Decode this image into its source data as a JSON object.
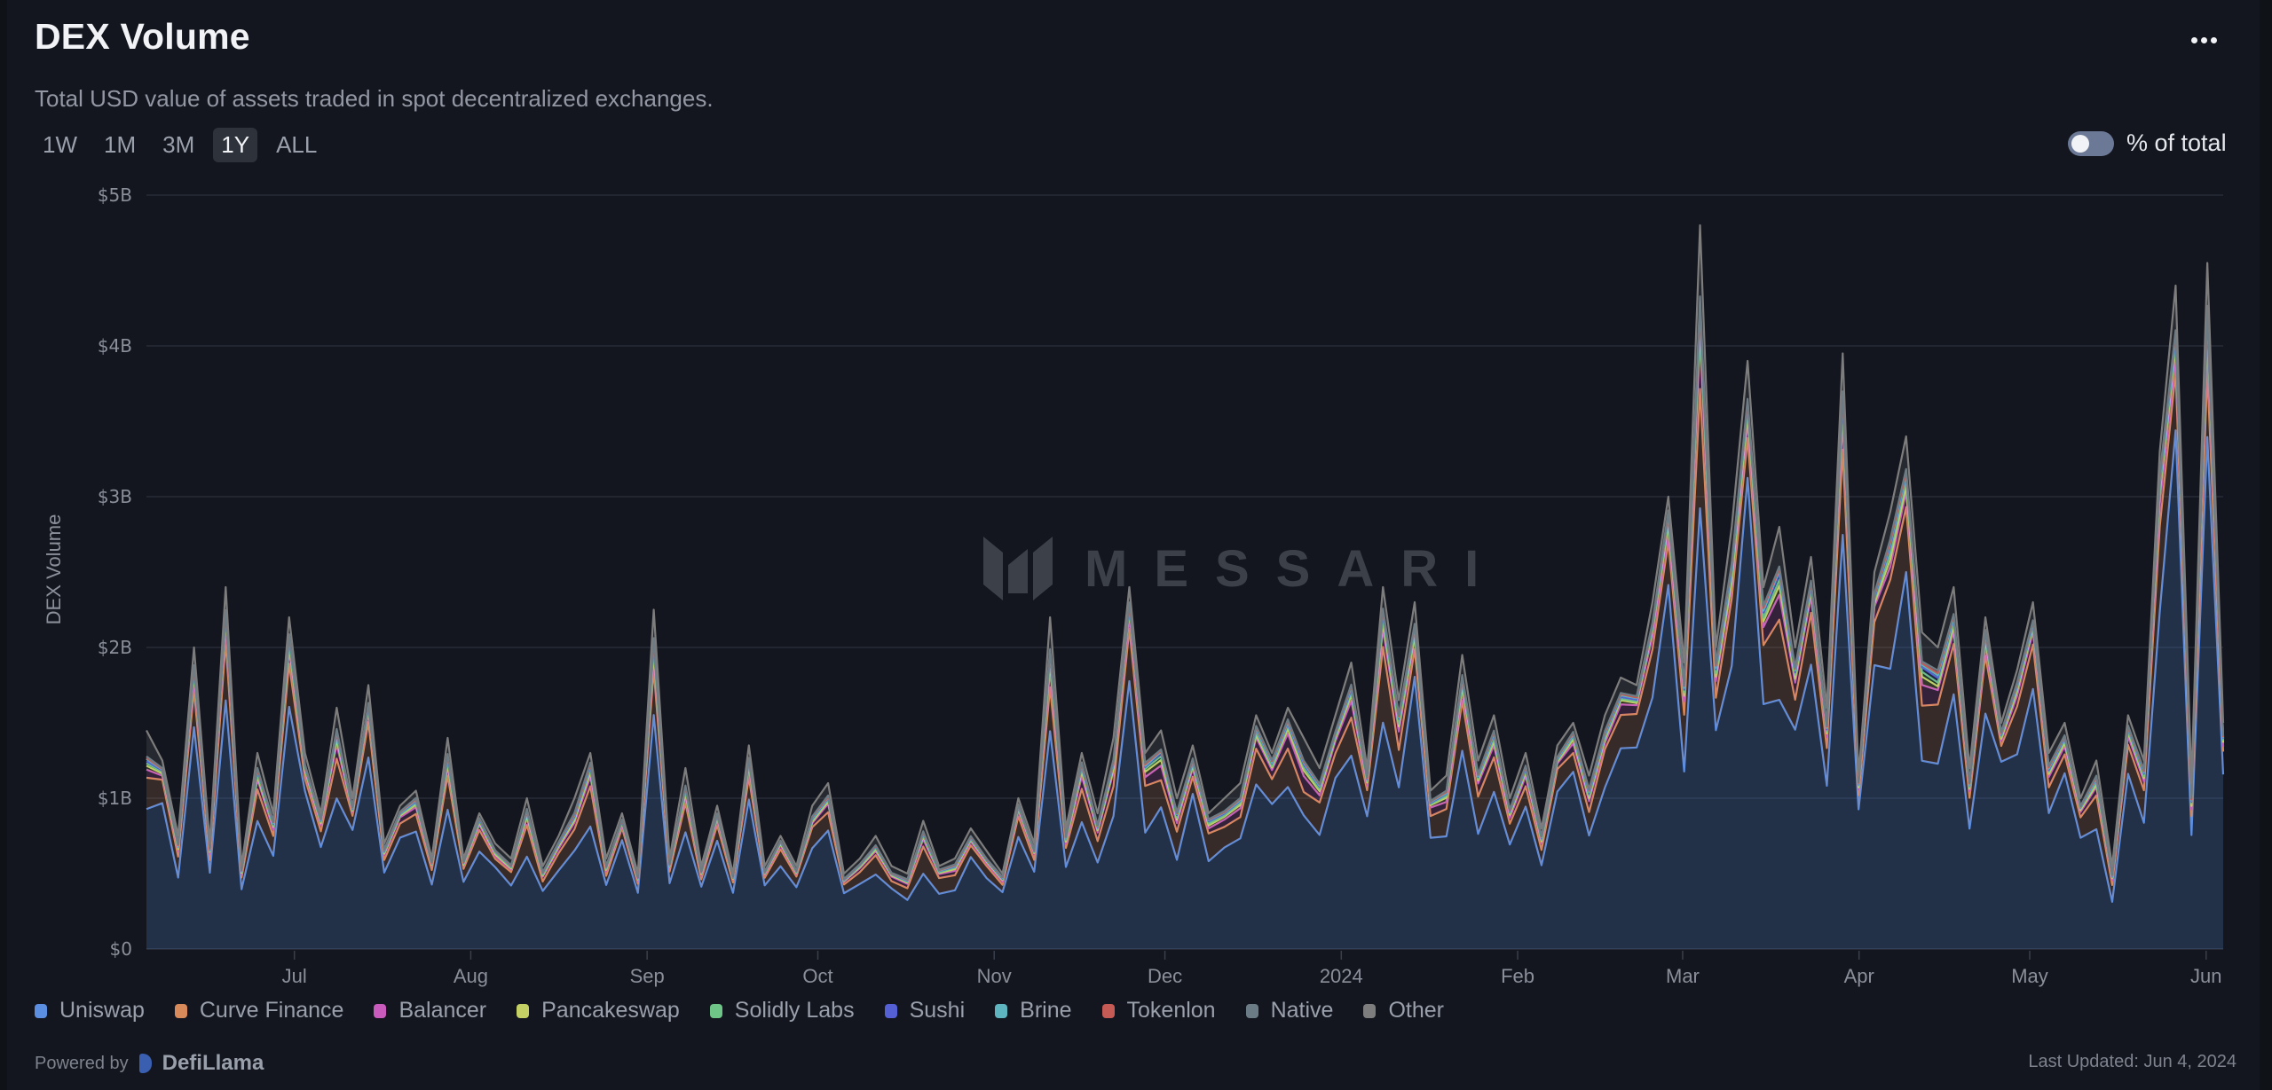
{
  "header": {
    "title": "DEX Volume",
    "subtitle": "Total USD value of assets traded in spot decentralized exchanges.",
    "more_icon": "ellipsis-icon"
  },
  "time_ranges": [
    {
      "label": "1W",
      "active": false
    },
    {
      "label": "1M",
      "active": false
    },
    {
      "label": "3M",
      "active": false
    },
    {
      "label": "1Y",
      "active": true
    },
    {
      "label": "ALL",
      "active": false
    }
  ],
  "percent_toggle": {
    "label": "% of total",
    "on": false
  },
  "watermark": "MESSARI",
  "footer": {
    "powered_by": "Powered by",
    "provider": "DefiLlama",
    "last_updated": "Last Updated: Jun 4, 2024"
  },
  "colors": {
    "background": "#13161e",
    "grid": "#262b36",
    "axis_text": "#8a8f9a"
  },
  "chart_data": {
    "type": "area",
    "stacked": true,
    "title": "DEX Volume",
    "ylabel": "DEX Volume",
    "xlabel": "",
    "yunit": "USD billions",
    "ylim": [
      0,
      5
    ],
    "yticks": [
      "$0",
      "$1B",
      "$2B",
      "$3B",
      "$4B",
      "$5B"
    ],
    "grid": true,
    "legend_position": "bottom-left",
    "x_start": "2023-06-05",
    "x_end": "2024-06-04",
    "x_step_days": 3,
    "xticks": [
      {
        "label": "Jul",
        "date": "2023-07-01"
      },
      {
        "label": "Aug",
        "date": "2023-08-01"
      },
      {
        "label": "Sep",
        "date": "2023-09-01"
      },
      {
        "label": "Oct",
        "date": "2023-10-01"
      },
      {
        "label": "Nov",
        "date": "2023-11-01"
      },
      {
        "label": "Dec",
        "date": "2023-12-01"
      },
      {
        "label": "2024",
        "date": "2024-01-01"
      },
      {
        "label": "Feb",
        "date": "2024-02-01"
      },
      {
        "label": "Mar",
        "date": "2024-03-01"
      },
      {
        "label": "Apr",
        "date": "2024-04-01"
      },
      {
        "label": "May",
        "date": "2024-05-01"
      },
      {
        "label": "Jun",
        "date": "2024-06-01"
      }
    ],
    "totals": [
      1.45,
      1.25,
      0.75,
      2.0,
      0.7,
      2.4,
      0.55,
      1.3,
      0.9,
      2.2,
      1.3,
      0.9,
      1.6,
      1.0,
      1.75,
      0.7,
      0.95,
      1.05,
      0.6,
      1.4,
      0.6,
      0.9,
      0.7,
      0.6,
      1.0,
      0.55,
      0.75,
      1.0,
      1.3,
      0.6,
      0.9,
      0.5,
      2.25,
      0.6,
      1.2,
      0.55,
      0.95,
      0.5,
      1.35,
      0.55,
      0.75,
      0.55,
      0.95,
      1.1,
      0.5,
      0.6,
      0.75,
      0.55,
      0.5,
      0.85,
      0.55,
      0.6,
      0.8,
      0.65,
      0.5,
      1.0,
      0.7,
      2.2,
      0.8,
      1.3,
      0.9,
      1.4,
      2.4,
      1.3,
      1.45,
      1.0,
      1.35,
      0.9,
      1.0,
      1.1,
      1.55,
      1.3,
      1.6,
      1.4,
      1.2,
      1.55,
      1.9,
      1.2,
      2.4,
      1.65,
      2.3,
      1.05,
      1.15,
      1.95,
      1.25,
      1.55,
      1.0,
      1.3,
      0.8,
      1.35,
      1.5,
      1.15,
      1.55,
      1.8,
      1.75,
      2.3,
      3.0,
      1.9,
      4.8,
      2.0,
      2.8,
      3.9,
      2.4,
      2.8,
      2.0,
      2.6,
      1.6,
      3.95,
      1.15,
      2.5,
      2.9,
      3.4,
      2.1,
      2.0,
      2.4,
      1.2,
      2.2,
      1.5,
      1.85,
      2.3,
      1.3,
      1.5,
      1.0,
      1.25,
      0.55,
      1.55,
      1.25,
      3.3,
      4.4,
      1.1,
      4.55,
      1.5
    ],
    "series": [
      {
        "name": "Uniswap",
        "color": "#5b8de0",
        "share_of_total": 0.72
      },
      {
        "name": "Curve Finance",
        "color": "#d98a5b",
        "share_of_total": 0.13
      },
      {
        "name": "Balancer",
        "color": "#c95bbd",
        "share_of_total": 0.04
      },
      {
        "name": "Pancakeswap",
        "color": "#c4cf64",
        "share_of_total": 0.015
      },
      {
        "name": "Solidly Labs",
        "color": "#6fc487",
        "share_of_total": 0.01
      },
      {
        "name": "Sushi",
        "color": "#5460d4",
        "share_of_total": 0.01
      },
      {
        "name": "Brine",
        "color": "#5fb5bf",
        "share_of_total": 0.005
      },
      {
        "name": "Tokenlon",
        "color": "#c65a54",
        "share_of_total": 0.005
      },
      {
        "name": "Native",
        "color": "#6c7c86",
        "share_of_total": 0.005
      },
      {
        "name": "Other",
        "color": "#7d7d7d",
        "share_of_total": 0.06
      }
    ]
  }
}
